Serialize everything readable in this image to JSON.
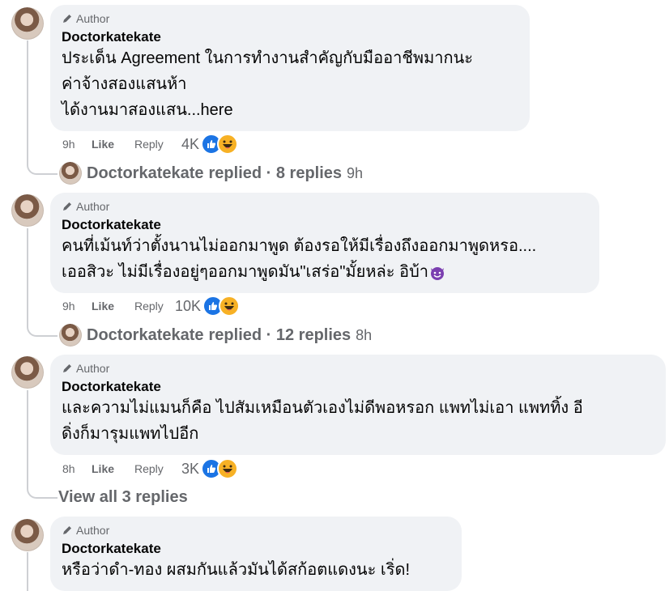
{
  "comments": [
    {
      "badge": "Author",
      "name": "Doctorkatekate",
      "text": "ประเด็น Agreement ในการทำงานสำคัญกับมืออาชีพมากนะ\nค่าจ้างสองแสนห้า\nได้งานมาสองแสน...here",
      "time": "9h",
      "like": "Like",
      "reply": "Reply",
      "count": "4K",
      "replied_name": "Doctorkatekate",
      "replied_text": "replied · 8 replies",
      "replied_time": "9h"
    },
    {
      "badge": "Author",
      "name": "Doctorkatekate",
      "text": "คนที่เม้นท์ว่าตั้งนานไม่ออกมาพูด ต้องรอให้มีเรื่องถึงออกมาพูดหรอ....\nเออสิวะ ไม่มีเรื่องอยู่ๆออกมาพูดมัน\"เสร่อ\"มั้ยหล่ะ อิบ้า",
      "time": "9h",
      "like": "Like",
      "reply": "Reply",
      "count": "10K",
      "replied_name": "Doctorkatekate",
      "replied_text": "replied · 12 replies",
      "replied_time": "8h"
    },
    {
      "badge": "Author",
      "name": "Doctorkatekate",
      "text": "และความไม่แมนก็คือ ไปสัมเหมือนตัวเองไม่ดีพอหรอก แพทไม่เอา แพททิ้ง อี\nดิ่งก็มารุมแพทไปอีก",
      "time": "8h",
      "like": "Like",
      "reply": "Reply",
      "count": "3K",
      "view_all": "View all 3 replies"
    },
    {
      "badge": "Author",
      "name": "Doctorkatekate",
      "text": "หรือว่าดำ-ทอง ผสมกันแล้วมันได้สก้อตแดงนะ เริ่ด!"
    }
  ],
  "icons": {
    "badge": "pen-icon",
    "like_reaction": "like-reaction-icon",
    "haha_reaction": "haha-reaction-icon",
    "devil_emoji": "smiling-devil-emoji-icon"
  },
  "colors": {
    "bubble": "#f0f2f5",
    "secondary_text": "#65676b",
    "like_blue": "#1b74e4",
    "haha_yellow": "#f7b125"
  }
}
